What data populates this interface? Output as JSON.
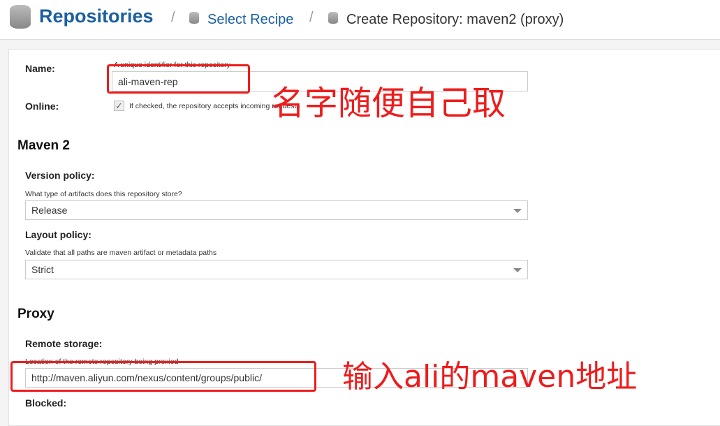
{
  "breadcrumb": {
    "root": "Repositories",
    "sep": "/",
    "recipe": "Select Recipe",
    "current": "Create Repository: maven2 (proxy)"
  },
  "form": {
    "name_label": "Name:",
    "name_help": "A unique identifier for this repository",
    "name_value": "ali-maven-rep",
    "online_label": "Online:",
    "online_help": "If checked, the repository accepts incoming requests",
    "online_checked": true,
    "maven_heading": "Maven 2",
    "version_label": "Version policy:",
    "version_help": "What type of artifacts does this repository store?",
    "version_value": "Release",
    "layout_label": "Layout policy:",
    "layout_help": "Validate that all paths are maven artifact or metadata paths",
    "layout_value": "Strict",
    "proxy_heading": "Proxy",
    "remote_label": "Remote storage:",
    "remote_help": "Location of the remote repository being proxied",
    "remote_value": "http://maven.aliyun.com/nexus/content/groups/public/",
    "blocked_label": "Blocked:"
  },
  "annotations": {
    "name_note": "名字随便自己取",
    "url_note": "输入ali的maven地址",
    "color": "#ee1c1c"
  }
}
